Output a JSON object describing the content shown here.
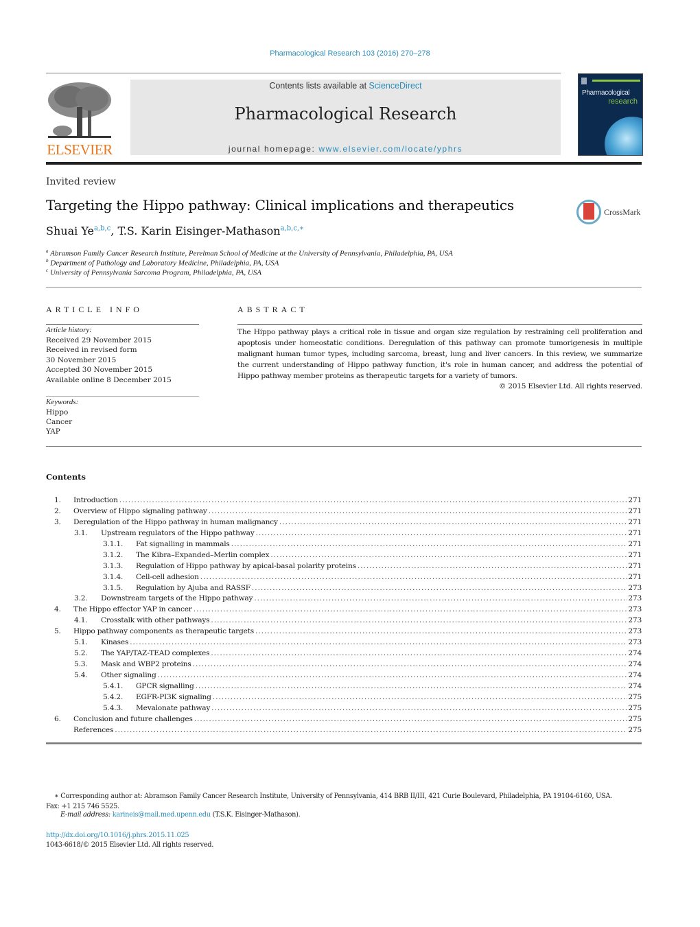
{
  "header": {
    "journal_ref": "Pharmacological Research 103 (2016) 270–278",
    "contents_prefix": "Contents lists available at ",
    "contents_link": "ScienceDirect",
    "journal_title": "Pharmacological Research",
    "homepage_prefix": "journal homepage: ",
    "homepage_link": "www.elsevier.com/locate/yphrs",
    "publisher_logo": "ELSEVIER",
    "cover_title_line1": "Pharmacological",
    "cover_title_line2": "research",
    "brand_colors": {
      "link": "#2a8cb8",
      "elsevier_orange": "#e8761e",
      "cover_green": "#8dc63f"
    }
  },
  "article": {
    "type": "Invited review",
    "title": "Targeting the Hippo pathway: Clinical implications and therapeutics",
    "crossmark_label": "CrossMark",
    "authors": [
      {
        "name": "Shuai Ye",
        "sup": "a,b,c"
      },
      {
        "name": "T.S. Karin Eisinger-Mathason",
        "sup": "a,b,c,∗"
      }
    ],
    "author_separator": ", ",
    "affiliations": [
      {
        "key": "a",
        "text": "Abramson Family Cancer Research Institute, Perelman School of Medicine at the University of Pennsylvania, Philadelphia, PA, USA"
      },
      {
        "key": "b",
        "text": "Department of Pathology and Laboratory Medicine, Philadelphia, PA, USA"
      },
      {
        "key": "c",
        "text": "University of Pennsylvania Sarcoma Program, Philadelphia, PA, USA"
      }
    ]
  },
  "article_info": {
    "heading": "ARTICLE INFO",
    "history_label": "Article history:",
    "history": [
      "Received 29 November 2015",
      "Received in revised form",
      "30 November 2015",
      "Accepted 30 November 2015",
      "Available online 8 December 2015"
    ],
    "keywords_label": "Keywords:",
    "keywords": [
      "Hippo",
      "Cancer",
      "YAP"
    ]
  },
  "abstract": {
    "heading": "ABSTRACT",
    "text": "The Hippo pathway plays a critical role in tissue and organ size regulation by restraining cell proliferation and apoptosis under homeostatic conditions. Deregulation of this pathway can promote tumorigenesis in multiple malignant human tumor types, including sarcoma, breast, lung and liver cancers. In this review, we summarize the current understanding of Hippo pathway function, it's role in human cancer, and address the potential of Hippo pathway member proteins as therapeutic targets for a variety of tumors.",
    "copyright": "© 2015 Elsevier Ltd. All rights reserved."
  },
  "contents": {
    "heading": "Contents",
    "items": [
      {
        "num": "1.",
        "title": "Introduction",
        "page": "271",
        "level": 0
      },
      {
        "num": "2.",
        "title": "Overview of Hippo signaling pathway",
        "page": "271",
        "level": 0
      },
      {
        "num": "3.",
        "title": "Deregulation of the Hippo pathway in human malignancy",
        "page": "271",
        "level": 0
      },
      {
        "num": "3.1.",
        "title": "Upstream regulators of the Hippo pathway",
        "page": "271",
        "level": 1
      },
      {
        "num": "3.1.1.",
        "title": "Fat signalling in mammals",
        "page": "271",
        "level": 2
      },
      {
        "num": "3.1.2.",
        "title": "The Kibra–Expanded–Merlin complex",
        "page": "271",
        "level": 2
      },
      {
        "num": "3.1.3.",
        "title": "Regulation of Hippo pathway by apical-basal polarity proteins",
        "page": "271",
        "level": 2
      },
      {
        "num": "3.1.4.",
        "title": "Cell-cell adhesion",
        "page": "271",
        "level": 2
      },
      {
        "num": "3.1.5.",
        "title": "Regulation by Ajuba and RASSF",
        "page": "273",
        "level": 2
      },
      {
        "num": "3.2.",
        "title": "Downstream targets of the Hippo pathway",
        "page": "273",
        "level": 1
      },
      {
        "num": "4.",
        "title": "The Hippo effector YAP in cancer",
        "page": "273",
        "level": 0
      },
      {
        "num": "4.1.",
        "title": "Crosstalk with other pathways",
        "page": "273",
        "level": 1
      },
      {
        "num": "5.",
        "title": "Hippo pathway components as therapeutic targets",
        "page": "273",
        "level": 0
      },
      {
        "num": "5.1.",
        "title": "Kinases",
        "page": "273",
        "level": 1
      },
      {
        "num": "5.2.",
        "title": "The YAP/TAZ-TEAD complexes",
        "page": "274",
        "level": 1
      },
      {
        "num": "5.3.",
        "title": "Mask and WBP2 proteins",
        "page": "274",
        "level": 1
      },
      {
        "num": "5.4.",
        "title": "Other signaling",
        "page": "274",
        "level": 1
      },
      {
        "num": "5.4.1.",
        "title": "GPCR signalling",
        "page": "274",
        "level": 2
      },
      {
        "num": "5.4.2.",
        "title": "EGFR-PI3K signaling",
        "page": "275",
        "level": 2
      },
      {
        "num": "5.4.3.",
        "title": "Mevalonate pathway",
        "page": "275",
        "level": 2
      },
      {
        "num": "6.",
        "title": "Conclusion and future challenges",
        "page": "275",
        "level": 0
      },
      {
        "num": "",
        "title": "References",
        "page": "275",
        "level": 0
      }
    ]
  },
  "footer": {
    "corresponding_mark": "∗",
    "corresponding_text": "Corresponding author at: Abramson Family Cancer Research Institute, University of Pennsylvania, 414 BRB II/III, 421 Curie Boulevard, Philadelphia, PA 19104-6160, USA.",
    "fax": "Fax: +1 215 746 5525.",
    "email_label": "E-mail address:",
    "email": "karineis@mail.med.upenn.edu",
    "email_owner": "(T.S.K. Eisinger-Mathason).",
    "doi": "http://dx.doi.org/10.1016/j.phrs.2015.11.025",
    "issn_copyright": "1043-6618/© 2015 Elsevier Ltd. All rights reserved."
  }
}
